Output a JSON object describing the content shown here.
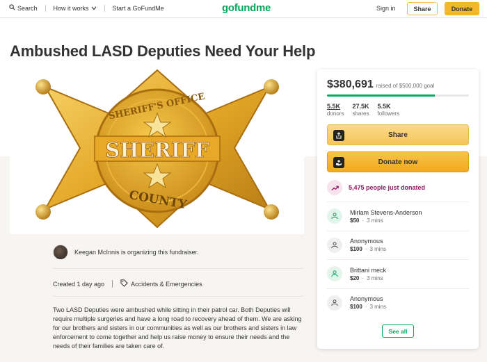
{
  "header": {
    "search_label": "Search",
    "how_it_works_label": "How it works",
    "start_label": "Start a GoFundMe",
    "logo_text": "gofundme",
    "signin_label": "Sign in",
    "share_label": "Share",
    "donate_label": "Donate"
  },
  "campaign": {
    "title": "Ambushed LASD Deputies Need Your Help",
    "badge_top": "SHERIFF'S OFFICE",
    "badge_main": "SHERIFF",
    "badge_bottom": "COUNTY",
    "organizer_text": "Keegan McInnis is organizing this fundraiser.",
    "created": "Created 1 day ago",
    "category": "Accidents & Emergencies",
    "story": "Two LASD Deputies were ambushed while sitting in their patrol car.  Both Deputies will require multiple surgeries and have a long road to recovery ahead of them. We are asking for our brothers and sisters in our communities as well as our brothers and sisters in law enforcement to come together and help us raise money to ensure their needs and the needs of their families  are taken care of."
  },
  "sidebar": {
    "raised": "$380,691",
    "goal_text": "raised of $500,000 goal",
    "progress_fraction": 0.761,
    "stats": [
      {
        "num": "5.5K",
        "label": "donors"
      },
      {
        "num": "27.5K",
        "label": "shares"
      },
      {
        "num": "5.5K",
        "label": "followers"
      }
    ],
    "share_label": "Share",
    "donate_label": "Donate now",
    "trend_text": "5,475 people just donated",
    "donations": [
      {
        "name": "Mirlam Stevens-Anderson",
        "amount": "$50",
        "time": "3 mins",
        "style": "green"
      },
      {
        "name": "Anonymous",
        "amount": "$100",
        "time": "3 mins",
        "style": "grey"
      },
      {
        "name": "Brittani meck",
        "amount": "$20",
        "time": "3 mins",
        "style": "green"
      },
      {
        "name": "Anonymous",
        "amount": "$100",
        "time": "3 mins",
        "style": "grey"
      }
    ],
    "see_all_label": "See all"
  },
  "colors": {
    "brand_green": "#02a95c",
    "donate_yellow": "#f5b72a",
    "trend_purple": "#8a1a62"
  }
}
